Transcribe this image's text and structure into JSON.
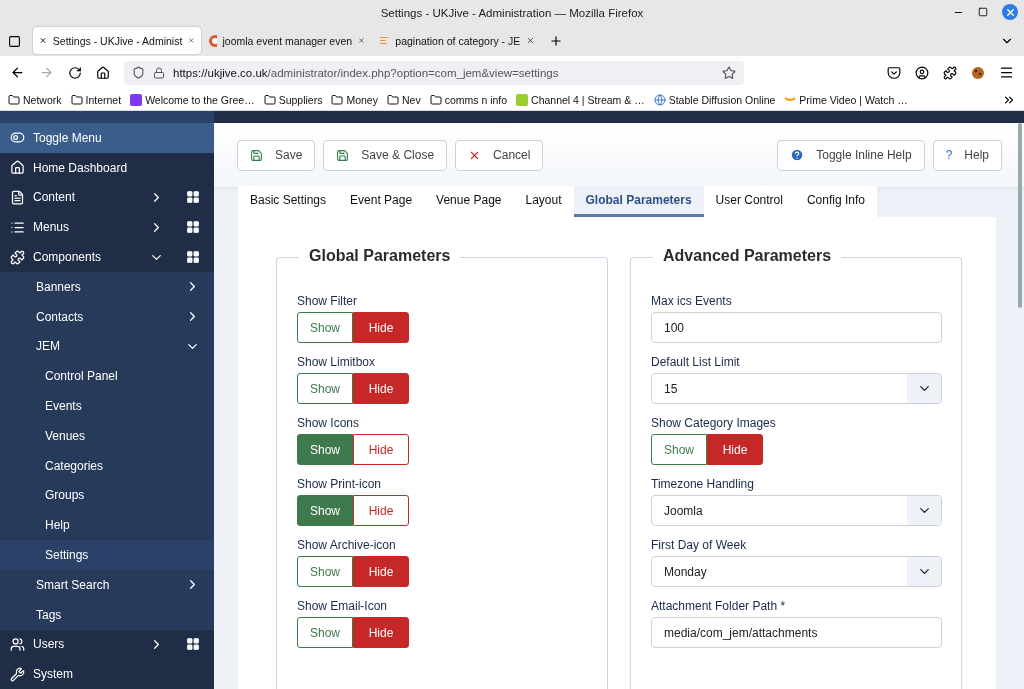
{
  "window": {
    "title": "Settings - UKJive - Administration — Mozilla Firefox"
  },
  "browser_tabs": [
    {
      "label": "Settings - UKJive - Administ",
      "selected": true,
      "kind": "joomla"
    },
    {
      "label": "joomla event manager even",
      "selected": false,
      "kind": "duck"
    },
    {
      "label": "pagination of category - JE",
      "selected": false,
      "kind": "list"
    }
  ],
  "address": {
    "host": "https://ukjive.co.uk",
    "path": "/administrator/index.php?option=com_jem&view=settings"
  },
  "bookmarks": [
    {
      "label": "Network",
      "kind": "folder"
    },
    {
      "label": "Internet",
      "kind": "folder"
    },
    {
      "label": "Welcome to the Gree…",
      "kind": "b"
    },
    {
      "label": "Suppliers",
      "kind": "folder"
    },
    {
      "label": "Money",
      "kind": "folder"
    },
    {
      "label": "Nev",
      "kind": "folder"
    },
    {
      "label": "comms n info",
      "kind": "folder"
    },
    {
      "label": "Channel 4 | Stream & …",
      "kind": "four"
    },
    {
      "label": "Stable Diffusion Online",
      "kind": "globe"
    },
    {
      "label": "Prime Video | Watch …",
      "kind": "amazon"
    }
  ],
  "sidebar": {
    "items": [
      {
        "label": "Toggle Menu",
        "selected": true
      },
      {
        "label": "Home Dashboard",
        "selected": false
      },
      {
        "label": "Content",
        "selected": false,
        "expanded": false,
        "grid": true
      },
      {
        "label": "Menus",
        "selected": false,
        "expanded": false,
        "grid": true
      },
      {
        "label": "Components",
        "selected": false,
        "expanded": true,
        "grid": true,
        "children": [
          {
            "label": "Banners",
            "selected": false,
            "expanded": false
          },
          {
            "label": "Contacts",
            "selected": false,
            "expanded": false
          },
          {
            "label": "JEM",
            "selected": false,
            "expanded": true,
            "children": [
              {
                "label": "Control Panel",
                "selected": false
              },
              {
                "label": "Events",
                "selected": false
              },
              {
                "label": "Venues",
                "selected": false
              },
              {
                "label": "Categories",
                "selected": false
              },
              {
                "label": "Groups",
                "selected": false
              },
              {
                "label": "Help",
                "selected": false
              },
              {
                "label": "Settings",
                "selected": true
              }
            ]
          },
          {
            "label": "Smart Search",
            "selected": false,
            "expanded": false
          },
          {
            "label": "Tags",
            "selected": false
          }
        ]
      },
      {
        "label": "Users",
        "selected": false,
        "expanded": false,
        "grid": true
      },
      {
        "label": "System",
        "selected": false
      }
    ]
  },
  "toolbar": {
    "left": [
      {
        "label": "Save",
        "kind": "save"
      },
      {
        "label": "Save & Close",
        "kind": "save"
      },
      {
        "label": "Cancel",
        "kind": "cancel"
      }
    ],
    "right": [
      {
        "label": "Toggle Inline Help",
        "kind": "info"
      },
      {
        "label": "Help",
        "kind": "question",
        "glyph": "?"
      }
    ]
  },
  "tabs": [
    {
      "label": "Basic Settings",
      "selected": false
    },
    {
      "label": "Event Page",
      "selected": false
    },
    {
      "label": "Venue Page",
      "selected": false
    },
    {
      "label": "Layout",
      "selected": false
    },
    {
      "label": "Global Parameters",
      "selected": true
    },
    {
      "label": "User Control",
      "selected": false
    },
    {
      "label": "Config Info",
      "selected": false
    }
  ],
  "fieldsets": [
    {
      "legend": "Global Parameters",
      "fields": [
        {
          "label": "Show Filter",
          "kind": "toggle",
          "options": [
            {
              "label": "Show",
              "selected": false
            },
            {
              "label": "Hide",
              "selected": true
            }
          ]
        },
        {
          "label": "Show Limitbox",
          "kind": "toggle",
          "options": [
            {
              "label": "Show",
              "selected": false
            },
            {
              "label": "Hide",
              "selected": true
            }
          ]
        },
        {
          "label": "Show Icons",
          "kind": "toggle",
          "options": [
            {
              "label": "Show",
              "selected": true
            },
            {
              "label": "Hide",
              "selected": false
            }
          ]
        },
        {
          "label": "Show Print-icon",
          "kind": "toggle",
          "options": [
            {
              "label": "Show",
              "selected": true
            },
            {
              "label": "Hide",
              "selected": false
            }
          ]
        },
        {
          "label": "Show Archive-icon",
          "kind": "toggle",
          "options": [
            {
              "label": "Show",
              "selected": false
            },
            {
              "label": "Hide",
              "selected": true
            }
          ]
        },
        {
          "label": "Show Email-Icon",
          "kind": "toggle",
          "options": [
            {
              "label": "Show",
              "selected": false
            },
            {
              "label": "Hide",
              "selected": true
            }
          ]
        }
      ]
    },
    {
      "legend": "Advanced Parameters",
      "fields": [
        {
          "label": "Max ics Events",
          "kind": "input",
          "value": "100"
        },
        {
          "label": "Default List Limit",
          "kind": "select",
          "value": "15"
        },
        {
          "label": "Show Category Images",
          "kind": "toggle",
          "options": [
            {
              "label": "Show",
              "selected": false
            },
            {
              "label": "Hide",
              "selected": true
            }
          ]
        },
        {
          "label": "Timezone Handling",
          "kind": "select",
          "value": "Joomla"
        },
        {
          "label": "First Day of Week",
          "kind": "select",
          "value": "Monday"
        },
        {
          "label": "Attachment Folder Path *",
          "kind": "input",
          "value": "media/com_jem/attachments"
        }
      ]
    }
  ]
}
